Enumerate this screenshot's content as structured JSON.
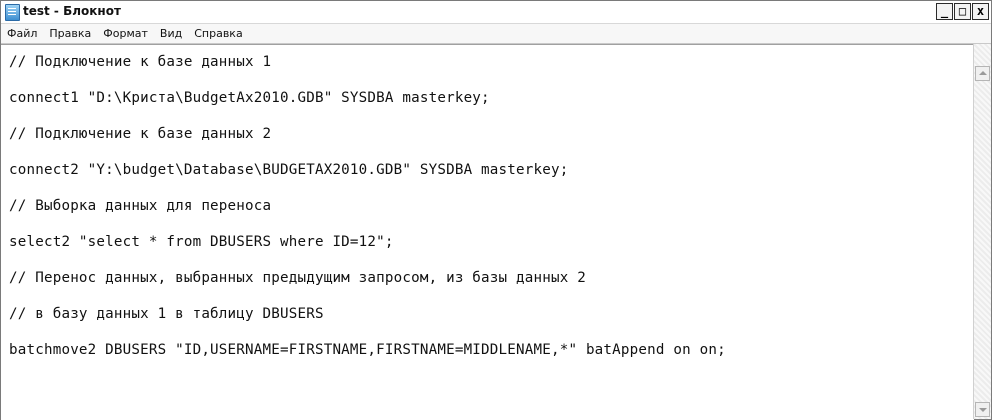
{
  "window": {
    "title": "test - Блокнот",
    "icon": "notepad-icon"
  },
  "window_buttons": {
    "minimize": "_",
    "maximize": "□",
    "close": "x"
  },
  "menu": [
    "Файл",
    "Правка",
    "Формат",
    "Вид",
    "Справка"
  ],
  "document": {
    "lines": [
      "// Подключение к базе данных 1",
      "connect1 \"D:\\Криста\\BudgetAx2010.GDB\" SYSDBA masterkey;",
      "// Подключение к базе данных 2",
      "connect2 \"Y:\\budget\\Database\\BUDGETAX2010.GDB\" SYSDBA masterkey;",
      "// Выборка данных для переноса",
      "select2 \"select * from DBUSERS where ID=12\";",
      "// Перенос данных, выбранных предыдущим запросом, из базы данных 2",
      "// в базу данных 1 в таблицу DBUSERS",
      "batchmove2 DBUSERS \"ID,USERNAME=FIRSTNAME,FIRSTNAME=MIDDLENAME,*\" batAppend on on;"
    ]
  }
}
